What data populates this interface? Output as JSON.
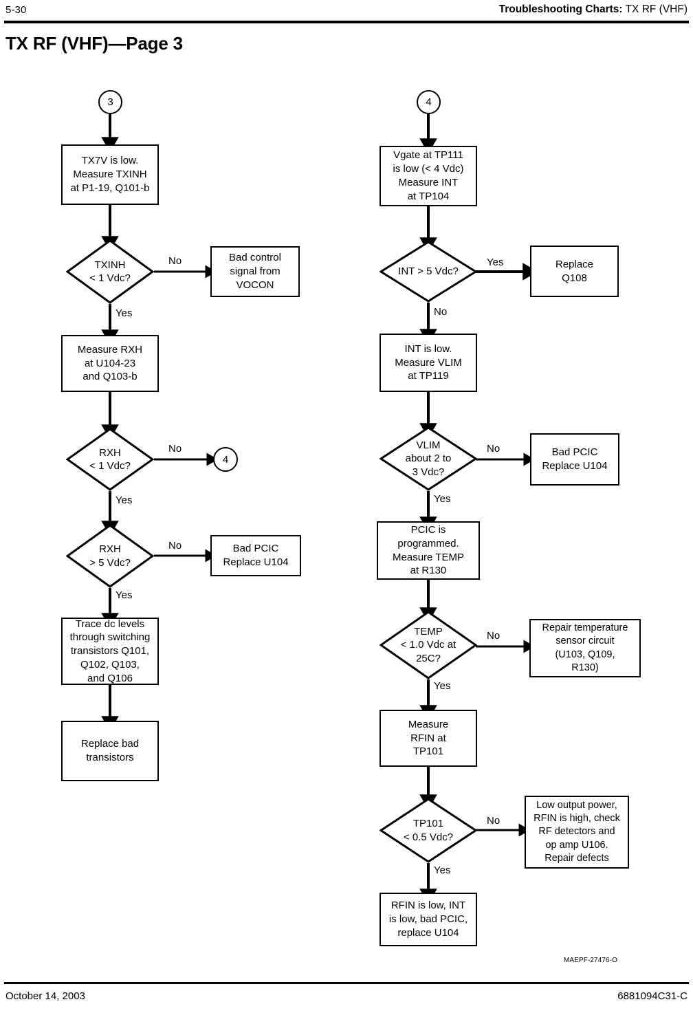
{
  "header": {
    "page_number": "5-30",
    "section_bold": "Troubleshooting Charts:",
    "section_rest": " TX RF (VHF)",
    "title": "TX RF (VHF)—Page 3"
  },
  "footer": {
    "date": "October 14, 2003",
    "doc_number": "6881094C31-C",
    "artwork_id": "MAEPF-27476-O"
  },
  "flow": {
    "left": {
      "connector_in": "3",
      "n1": "TX7V is low.\nMeasure TXINH\nat P1-19, Q101-b",
      "d1": "TXINH\n< 1 Vdc?",
      "d1_no_label": "No",
      "d1_no_target": "Bad control\nsignal from\nVOCON",
      "d1_yes_label": "Yes",
      "n2": "Measure RXH\nat U104-23\nand Q103-b",
      "d2": "RXH\n< 1 Vdc?",
      "d2_no_label": "No",
      "d2_no_connector": "4",
      "d2_yes_label": "Yes",
      "d3": "RXH\n> 5 Vdc?",
      "d3_no_label": "No",
      "d3_no_target": "Bad PCIC\nReplace U104",
      "d3_yes_label": "Yes",
      "n3": "Trace dc levels\nthrough switching\ntransistors Q101,\nQ102, Q103,\nand Q106",
      "n4": "Replace bad\ntransistors"
    },
    "right": {
      "connector_in": "4",
      "n1": "Vgate at TP111\nis low (< 4 Vdc)\nMeasure INT\nat TP104",
      "d1": "INT > 5 Vdc?",
      "d1_yes_label": "Yes",
      "d1_yes_target": "Replace\nQ108",
      "d1_no_label": "No",
      "n2": "INT is low.\nMeasure VLIM\nat TP119",
      "d2": "VLIM\nabout 2 to\n3 Vdc?",
      "d2_no_label": "No",
      "d2_no_target": "Bad PCIC\nReplace U104",
      "d2_yes_label": "Yes",
      "n3": "PCIC is\nprogrammed.\nMeasure TEMP\nat R130",
      "d3": "TEMP\n< 1.0 Vdc at\n25C?",
      "d3_no_label": "No",
      "d3_no_target": "Repair temperature\nsensor circuit\n(U103, Q109,\nR130)",
      "d3_yes_label": "Yes",
      "n4": "Measure\nRFIN at\nTP101",
      "d4": "TP101\n< 0.5 Vdc?",
      "d4_no_label": "No",
      "d4_no_target": "Low output power,\nRFIN is high, check\nRF detectors and\nop amp U106.\nRepair defects",
      "d4_yes_label": "Yes",
      "n5": "RFIN is low, INT\nis low, bad PCIC,\nreplace U104"
    }
  }
}
